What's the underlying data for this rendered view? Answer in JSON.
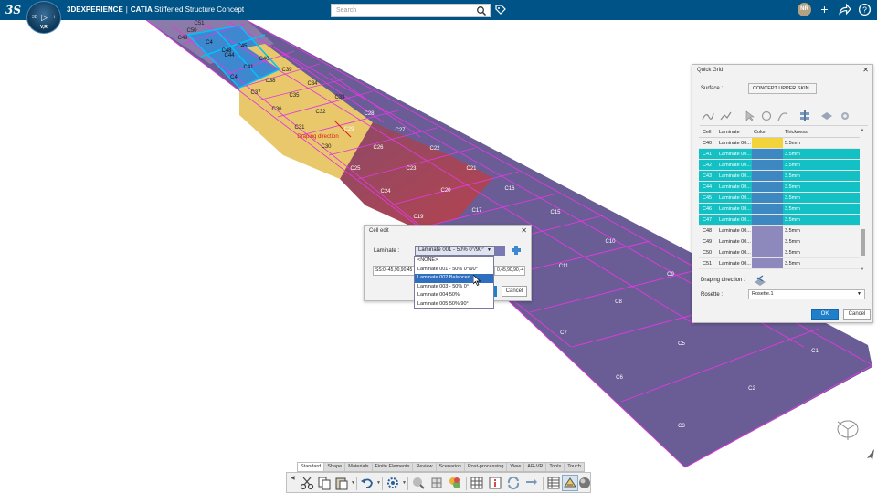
{
  "header": {
    "brand": "3DEXPERIENCE",
    "app": "CATIA",
    "doc": "Stiffened Structure Concept",
    "separator": "|",
    "compass_left": "3D",
    "compass_right": "i",
    "compass_version": "V,R",
    "search_placeholder": "Search",
    "avatar": "NR"
  },
  "model": {
    "labels": {
      "c1": "C1",
      "c2": "C2",
      "c3": "C3",
      "c5": "C5",
      "c6": "C6",
      "c7": "C7",
      "c8": "C8",
      "c9": "C9",
      "c10": "C10",
      "c11": "C11",
      "c15": "C15",
      "c16": "C16",
      "c17": "C17",
      "c19": "C19",
      "c20": "C20",
      "c21": "C21",
      "c22": "C22",
      "c23": "C23",
      "c24": "C24",
      "c25": "C25",
      "c26": "C26",
      "c27": "C27",
      "c28": "C28",
      "c29": "C29",
      "c30": "C30",
      "c31": "C31",
      "c32": "C32",
      "c33": "C33",
      "c34": "C34",
      "c35": "C35",
      "c36": "C36",
      "c37": "C37",
      "c38": "C38",
      "c39": "C39",
      "c40": "C40",
      "c41": "C41",
      "c44": "C44",
      "c45": "C45",
      "c48": "C48",
      "c49": "C49",
      "c50": "C50",
      "c51": "C51",
      "c4x": "C4",
      "c4y": "C4"
    },
    "draping_label": "Draping direction"
  },
  "cell_edit": {
    "title": "Cell edit",
    "laminate_label": "Laminate :",
    "laminate_value": "Laminate 001 - 50% 0°/90°",
    "stacking_left": "SS:0,-45,90,90,45",
    "stacking_right": "0,45,90,90,-4",
    "cancel_label": "Cancel",
    "options": [
      "<NONE>",
      "Laminate 001 - 50% 0°/90°",
      "Laminate 002 Balanced",
      "Laminate 003 - 50% 0°",
      "Laminate 004 50%",
      "Laminate 005 50% 90°"
    ],
    "selected_option": "Laminate 002 Balanced"
  },
  "quick_grid": {
    "title": "Quick Grid",
    "surface_label": "Surface :",
    "surface_value": "CONCEPT UPPER SKIN",
    "columns": [
      "Cell",
      "Laminate",
      "Color",
      "Thickness"
    ],
    "rows": [
      {
        "cell": "C40",
        "laminate": "Laminate 00...",
        "thickness": "5.5mm"
      },
      {
        "cell": "C41",
        "laminate": "Laminate 00...",
        "thickness": "3.5mm"
      },
      {
        "cell": "C42",
        "laminate": "Laminate 00...",
        "thickness": "3.5mm"
      },
      {
        "cell": "C43",
        "laminate": "Laminate 00...",
        "thickness": "3.5mm"
      },
      {
        "cell": "C44",
        "laminate": "Laminate 00...",
        "thickness": "3.5mm"
      },
      {
        "cell": "C45",
        "laminate": "Laminate 00...",
        "thickness": "3.5mm"
      },
      {
        "cell": "C46",
        "laminate": "Laminate 00...",
        "thickness": "3.5mm"
      },
      {
        "cell": "C47",
        "laminate": "Laminate 00...",
        "thickness": "3.5mm"
      },
      {
        "cell": "C48",
        "laminate": "Laminate 00...",
        "thickness": "3.5mm"
      },
      {
        "cell": "C49",
        "laminate": "Laminate 00...",
        "thickness": "3.5mm"
      },
      {
        "cell": "C50",
        "laminate": "Laminate 00...",
        "thickness": "3.5mm"
      },
      {
        "cell": "C51",
        "laminate": "Laminate 00...",
        "thickness": "3.5mm"
      }
    ],
    "draping_label": "Draping direction :",
    "rosette_label": "Rosette :",
    "rosette_value": "Rosette.1",
    "ok_label": "OK",
    "cancel_label": "Cancel"
  },
  "action_bar": {
    "tabs": [
      "Standard",
      "Shape",
      "Materials",
      "Finite Elements",
      "Review",
      "Scenarios",
      "Post-processing",
      "View",
      "AR-VR",
      "Tools",
      "Touch"
    ],
    "icons": [
      "cut-icon",
      "copy-icon",
      "paste-icon",
      "undo-icon",
      "settings-icon",
      "measure-icon",
      "rosette-icon",
      "material-icon",
      "grid-icon",
      "info-icon",
      "update-icon",
      "sync-icon",
      "table-icon",
      "draping-icon",
      "render-icon"
    ]
  },
  "colors": {
    "topbar": "#005386",
    "purple_panel": "#6a5c95",
    "red_panel": "#9a4a66",
    "yellow_panel": "#e8c86a",
    "blue_panel": "#3d88cf",
    "grid_line": "#e03ae0",
    "selection": "#13c1c4",
    "ok_button": "#1f7fc8"
  }
}
